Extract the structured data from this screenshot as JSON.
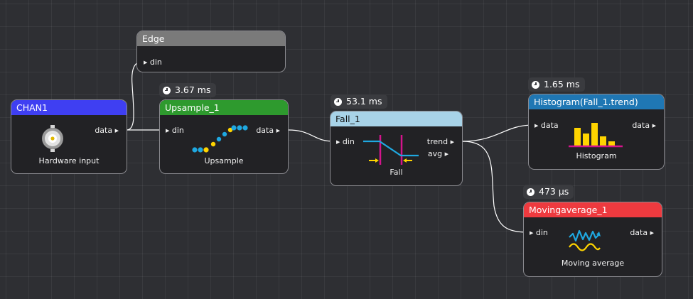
{
  "nodes": {
    "edge": {
      "title": "Edge",
      "in": "din",
      "color": "#7a7a7a"
    },
    "chan1": {
      "title": "CHAN1",
      "out": "data",
      "caption": "Hardware input",
      "color": "#3f3ff2"
    },
    "upsample": {
      "title": "Upsample_1",
      "in": "din",
      "out": "data",
      "caption": "Upsample",
      "timing": "3.67 ms",
      "color": "#2e9a2e"
    },
    "fall": {
      "title": "Fall_1",
      "in": "din",
      "out1": "trend",
      "out2": "avg",
      "caption": "Fall",
      "timing": "53.1 ms",
      "color": "#a8d3e8"
    },
    "histogram": {
      "title": "Histogram(Fall_1.trend)",
      "in": "data",
      "out": "data",
      "caption": "Histogram",
      "timing": "1.65 ms",
      "color": "#1f77b4"
    },
    "movingavg": {
      "title": "Movingaverage_1",
      "in": "din",
      "out": "data",
      "caption": "Moving average",
      "timing": "473 µs",
      "color": "#ee3a3f"
    }
  },
  "icons": {
    "chan1": "bnc-connector-icon",
    "upsample": "upsample-dots-icon",
    "fall": "fall-edge-icon",
    "histogram": "histogram-bars-icon",
    "movingavg": "moving-average-waves-icon"
  }
}
